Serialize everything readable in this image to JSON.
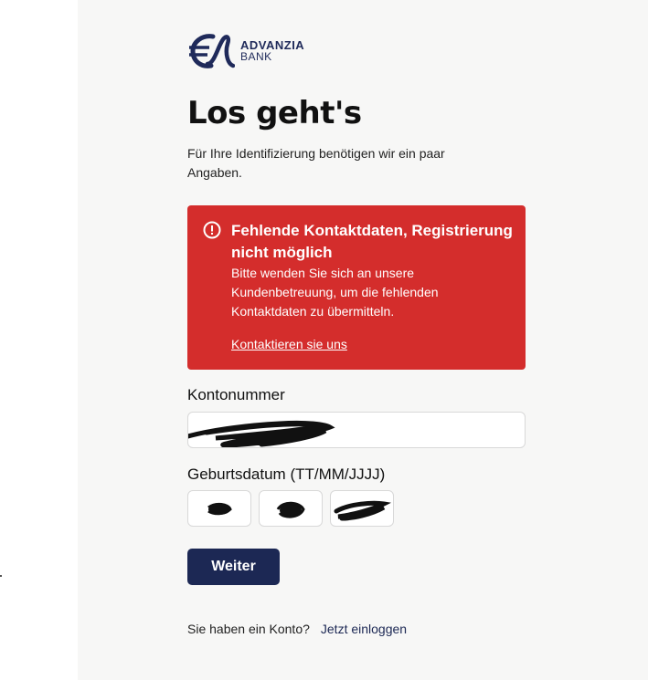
{
  "brand": {
    "line1": "ADVANZIA",
    "line2": "BANK",
    "color": "#1f2a5a"
  },
  "page": {
    "title": "Los geht's",
    "intro": "Für Ihre Identifizierung benötigen wir ein paar Angaben."
  },
  "alert": {
    "icon": "exclamation-circle-icon",
    "title": "Fehlende Kontaktdaten, Registrierung nicht möglich",
    "body": "Bitte wenden Sie sich an unsere Kundenbetreuung, um die fehlenden Kontaktdaten zu übermitteln.",
    "link": "Kontaktieren sie uns",
    "color": "#d42d2c"
  },
  "form": {
    "account_label": "Kontonummer",
    "birthdate_label": "Geburtsdatum (TT/MM/JJJJ)",
    "submit": "Weiter"
  },
  "footer": {
    "question": "Sie haben ein Konto?",
    "login_link": "Jetzt einloggen"
  },
  "colors": {
    "primary": "#1c2854",
    "panel": "#f7f7f6"
  }
}
